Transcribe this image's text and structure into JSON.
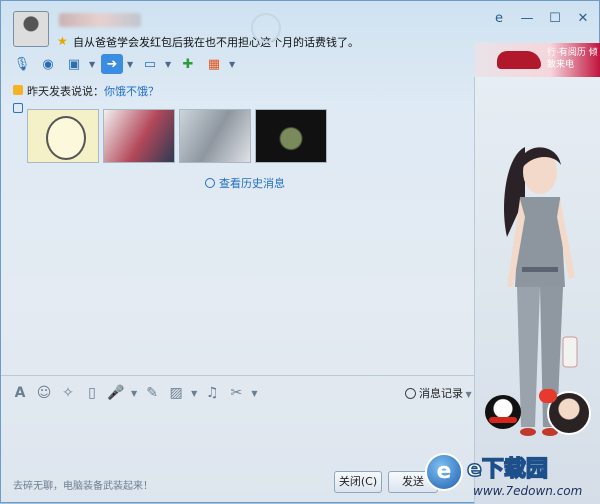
{
  "title_bar": {
    "signature": "自从爸爸学会发红包后我在也不用担心这个月的话费钱了。",
    "window_buttons": [
      "e",
      "—",
      "☐",
      "✕"
    ]
  },
  "ad_banner": {
    "text": "行·有阅历 倾致来电"
  },
  "chat": {
    "post_prefix": "昨天发表说说：",
    "post_link": "你饿不饿？",
    "history_link": "查看历史消息",
    "photo_count": 4
  },
  "input_toolbar": {
    "message_record": "消息记录"
  },
  "footer": {
    "ad_text": "去碎无聊，电脑装备武装起来！",
    "close_button": "关闭(C)",
    "send_button": "发送"
  },
  "watermark": {
    "site_name": "e下载园",
    "badge": "e",
    "url": "www.7edown.com"
  }
}
